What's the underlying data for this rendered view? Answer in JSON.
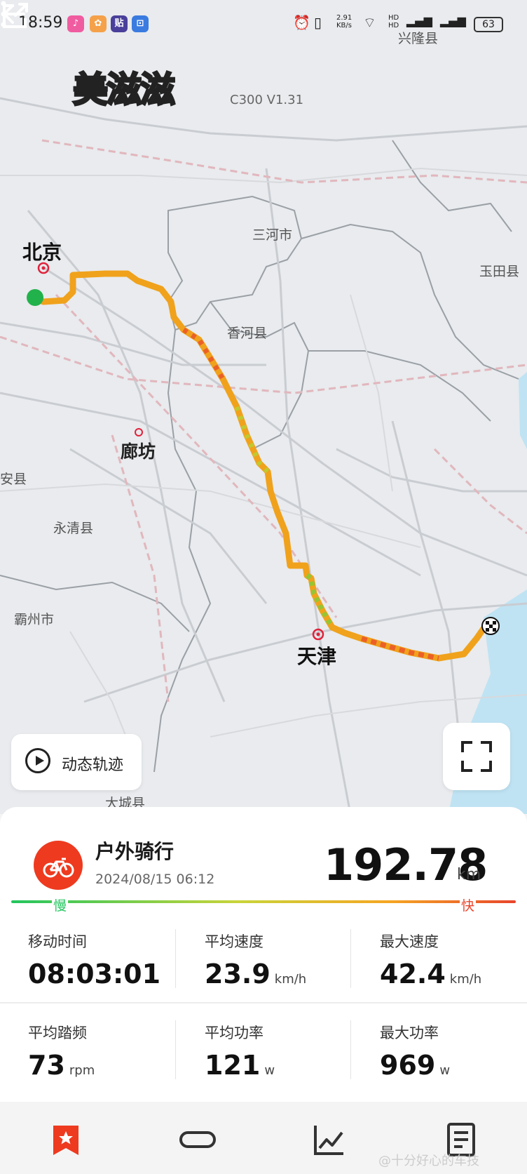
{
  "status_bar": {
    "time": "18:59",
    "net_speed": "2.91\nKB/s",
    "battery": "63"
  },
  "header": {
    "logo_text": "美滋滋",
    "device_label": "C300  V1.31"
  },
  "map": {
    "labels": {
      "beijing": "北京",
      "sanhe": "三河市",
      "xinglong": "兴隆县",
      "yutian": "玉田县",
      "xianghe": "香河县",
      "langfang": "廊坊",
      "anxian": "安县",
      "yongqing": "永清县",
      "bazhou": "霸州市",
      "tianjin": "天津",
      "dacheng": "大城县"
    },
    "route_colors": {
      "slow": "#22c55e",
      "mid": "#f5a623",
      "fast": "#e8452c"
    }
  },
  "controls": {
    "dynamic_track_label": "动态轨迹"
  },
  "activity": {
    "title": "户外骑行",
    "date": "2024/08/15 06:12",
    "distance": "192.78",
    "distance_unit": "km",
    "slow_label": "慢",
    "fast_label": "快"
  },
  "stats": [
    {
      "label": "移动时间",
      "value": "08:03:01",
      "unit": ""
    },
    {
      "label": "平均速度",
      "value": "23.9",
      "unit": "km/h"
    },
    {
      "label": "最大速度",
      "value": "42.4",
      "unit": "km/h"
    },
    {
      "label": "平均踏频",
      "value": "73",
      "unit": "rpm"
    },
    {
      "label": "平均功率",
      "value": "121",
      "unit": "w"
    },
    {
      "label": "最大功率",
      "value": "969",
      "unit": "w"
    }
  ],
  "tabs": [
    {
      "name": "tab-summary",
      "icon": "star-bookmark-icon",
      "active": true
    },
    {
      "name": "tab-laps",
      "icon": "loop-icon",
      "active": false
    },
    {
      "name": "tab-charts",
      "icon": "line-chart-icon",
      "active": false
    },
    {
      "name": "tab-details",
      "icon": "document-icon",
      "active": false
    }
  ],
  "watermark": "@十分好心的车技"
}
